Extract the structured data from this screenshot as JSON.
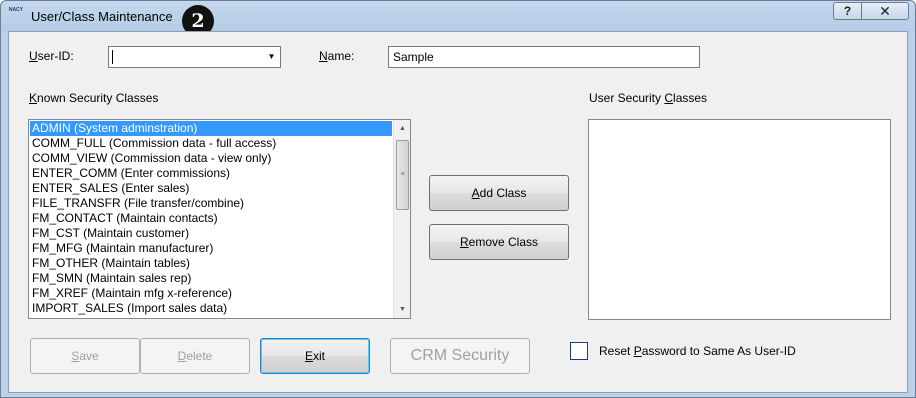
{
  "window": {
    "title": "User/Class Maintenance",
    "step_badge": "2",
    "app_icon_text": "NACY"
  },
  "title_buttons": {
    "help": "?",
    "close": "✕"
  },
  "form": {
    "user_id": {
      "label": "User-ID:",
      "value": ""
    },
    "name": {
      "label": "Name:",
      "value": "Sample"
    }
  },
  "known_classes": {
    "label": "Known Security Classes",
    "items": [
      "ADMIN (System adminstration)",
      "COMM_FULL (Commission data - full access)",
      "COMM_VIEW (Commission data - view only)",
      "ENTER_COMM (Enter commissions)",
      "ENTER_SALES (Enter sales)",
      "FILE_TRANSFR (File transfer/combine)",
      "FM_CONTACT (Maintain contacts)",
      "FM_CST (Maintain customer)",
      "FM_MFG (Maintain manufacturer)",
      "FM_OTHER (Maintain tables)",
      "FM_SMN (Maintain sales rep)",
      "FM_XREF (Maintain mfg x-reference)",
      "IMPORT_SALES (Import sales data)"
    ],
    "selected_index": 0
  },
  "user_classes": {
    "label": "User Security Classes",
    "items": []
  },
  "buttons": {
    "add_class": "Add Class",
    "remove_class": "Remove Class",
    "save": "Save",
    "delete": "Delete",
    "exit": "Exit",
    "crm_security": "CRM Security"
  },
  "reset_password": {
    "label": "Reset Password to Same As User-ID",
    "checked": false
  },
  "colors": {
    "selection": "#3399ff",
    "window_frame": "#b9d1ea",
    "dialog_bg": "#f0f0f0"
  },
  "icons": {
    "help": "help-icon",
    "close": "close-icon",
    "dropdown": "chevron-down-icon",
    "scroll_up": "chevron-up-icon",
    "scroll_down": "chevron-down-icon"
  }
}
